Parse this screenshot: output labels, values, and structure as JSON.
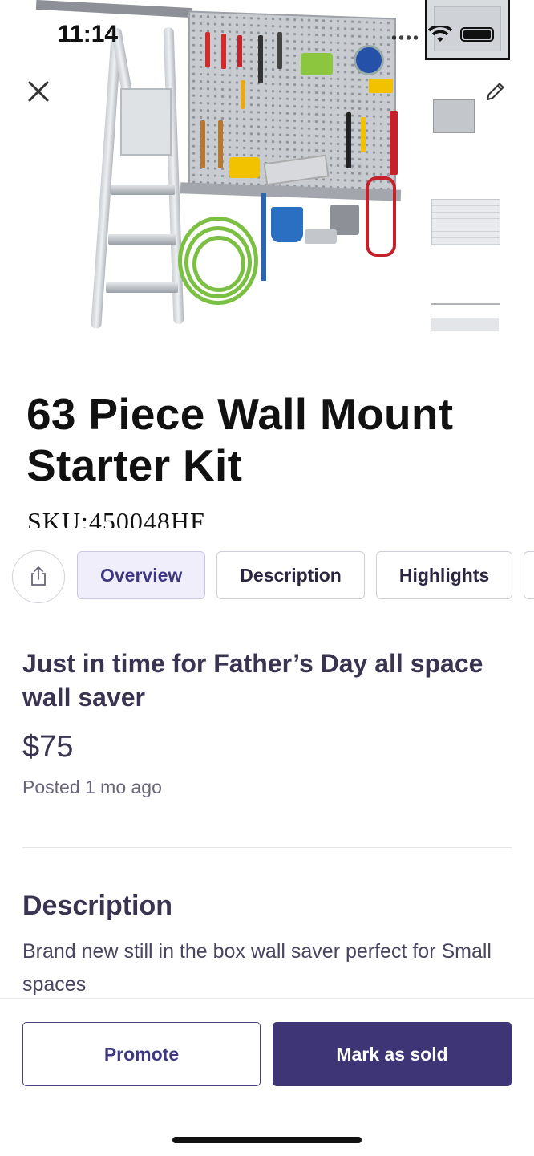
{
  "status_bar": {
    "time": "11:14"
  },
  "listing": {
    "title": "63 Piece Wall Mount Starter Kit",
    "sku": "SKU:450048HF",
    "headline": "Just in time for Father’s Day all space wall saver",
    "price": "$75",
    "posted": "Posted 1 mo ago"
  },
  "tabs": [
    {
      "label": "Overview",
      "active": true
    },
    {
      "label": "Description",
      "active": false
    },
    {
      "label": "Highlights",
      "active": false
    }
  ],
  "description": {
    "heading": "Description",
    "text": "Brand new still in the box wall saver perfect for Small spaces"
  },
  "actions": {
    "promote": "Promote",
    "mark_sold": "Mark as sold"
  },
  "icons": {
    "close": "close-icon",
    "edit": "pencil-icon",
    "share": "share-icon"
  },
  "colors": {
    "accent": "#3d3575",
    "active_tab_bg": "#efeefa",
    "text": "#3a3450"
  }
}
